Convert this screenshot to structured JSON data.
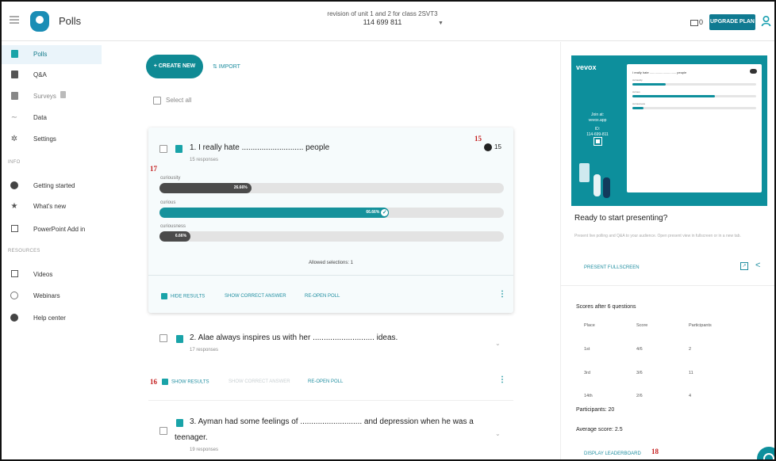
{
  "app": {
    "title": "Polls"
  },
  "session": {
    "name": "revision of unit 1 and 2 for class 2SVT3",
    "id": "114 699 811"
  },
  "header": {
    "devices_count": "0",
    "upgrade_label": "UPGRADE PLAN"
  },
  "sidebar": {
    "items": [
      {
        "label": "Polls",
        "icon": "poll-icon"
      },
      {
        "label": "Q&A",
        "icon": "qa-icon"
      },
      {
        "label": "Surveys",
        "icon": "survey-icon"
      },
      {
        "label": "Data",
        "icon": "data-icon"
      },
      {
        "label": "Settings",
        "icon": "gear-icon"
      }
    ],
    "info_label": "INFO",
    "info_items": [
      {
        "label": "Getting started",
        "icon": "info-icon"
      },
      {
        "label": "What's new",
        "icon": "star-icon"
      },
      {
        "label": "PowerPoint Add in",
        "icon": "powerpoint-icon"
      }
    ],
    "resources_label": "RESOURCES",
    "resource_items": [
      {
        "label": "Videos",
        "icon": "video-icon"
      },
      {
        "label": "Webinars",
        "icon": "clock-icon"
      },
      {
        "label": "Help center",
        "icon": "help-icon"
      }
    ]
  },
  "toolbar": {
    "create_label": "+ CREATE NEW",
    "import_label": "⇅ IMPORT",
    "select_all_label": "Select all"
  },
  "polls": [
    {
      "title": "1. I really hate ............................ people",
      "responses": "15 responses",
      "count": "15",
      "options": [
        {
          "label": "curiousity",
          "percent": 26.66,
          "percent_label": "26.66%"
        },
        {
          "label": "curious",
          "percent": 66.66,
          "percent_label": "66.66%"
        },
        {
          "label": "curiousness",
          "percent": 6.66,
          "percent_label": "6.66%"
        }
      ],
      "allowed": "Allowed selections: 1",
      "actions": {
        "results": "HIDE RESULTS",
        "correct": "SHOW CORRECT ANSWER",
        "reopen": "RE-OPEN POLL"
      }
    },
    {
      "title": "2. Alae always inspires us with her ............................ ideas.",
      "responses": "17 responses",
      "actions": {
        "results": "SHOW RESULTS",
        "correct": "SHOW CORRECT ANSWER",
        "reopen": "RE-OPEN POLL"
      }
    },
    {
      "title_line1": "3. Ayman had some feelings of ............................ and depression when he was a",
      "title_line2": "teenager.",
      "responses": "19 responses"
    }
  ],
  "annotations": {
    "a15": "15",
    "a16": "16",
    "a17": "17",
    "a18": "18"
  },
  "preview": {
    "brand": "vevox",
    "join_line1": "Join at:",
    "join_line2": "vevox.app",
    "id_label": "ID:",
    "id": "114-699-811",
    "question": "I really hate .............................. people",
    "options": [
      {
        "label": "curiousity",
        "percent": 26.66,
        "percent_label": "26.66%"
      },
      {
        "label": "curious",
        "percent": 66.66,
        "percent_label": "66.66%"
      },
      {
        "label": "curiousness",
        "percent": 6.66,
        "percent_label": "6.66%"
      }
    ]
  },
  "right_panel": {
    "ready_title": "Ready to start presenting?",
    "ready_sub": "Present live polling and Q&A to your audience. Open present view in fullscreen or in a new tab.",
    "present_label": "PRESENT FULLSCREEN",
    "scores_title": "Scores after 6 questions",
    "columns": [
      "Place",
      "Score",
      "Participants"
    ],
    "rows": [
      [
        "1st",
        "4/6",
        "2"
      ],
      [
        "3rd",
        "3/6",
        "11"
      ],
      [
        "14th",
        "2/6",
        "4"
      ]
    ],
    "participants": "Participants: 20",
    "average": "Average score: 2.5",
    "leaderboard_label": "DISPLAY LEADERBOARD"
  },
  "colors": {
    "accent": "#0f8a94",
    "teal_bar": "#16929c",
    "dark_bar": "#4b4b4b",
    "annotation": "#c41e1e"
  }
}
